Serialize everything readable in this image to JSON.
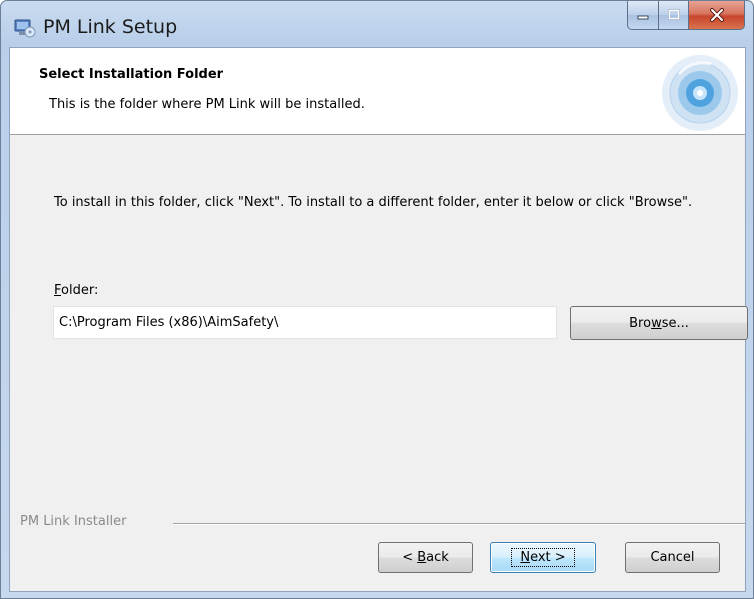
{
  "window": {
    "title": "PM Link Setup",
    "controls": [
      "minimize",
      "maximize",
      "close"
    ]
  },
  "banner": {
    "title": "Select Installation Folder",
    "subtitle": "This is the folder where PM Link will be installed."
  },
  "instructions": "To install in this folder, click \"Next\". To install to a different folder, enter it below or click \"Browse\".",
  "folder": {
    "label_mnemonic": "F",
    "label_rest": "older:",
    "value": "C:\\Program Files (x86)\\AimSafety\\"
  },
  "buttons": {
    "browse_pre": "Bro",
    "browse_mnemonic": "w",
    "browse_post": "se...",
    "back_pre": "< ",
    "back_mnemonic": "B",
    "back_post": "ack",
    "next_mnemonic": "N",
    "next_post": "ext >",
    "cancel": "Cancel"
  },
  "footer": {
    "label": "PM Link Installer"
  },
  "colors": {
    "title_bar": "#b9cfe9",
    "close_button": "#c8452c",
    "client_bg": "#f0f0f0",
    "default_button_border": "#3c7fb1"
  }
}
